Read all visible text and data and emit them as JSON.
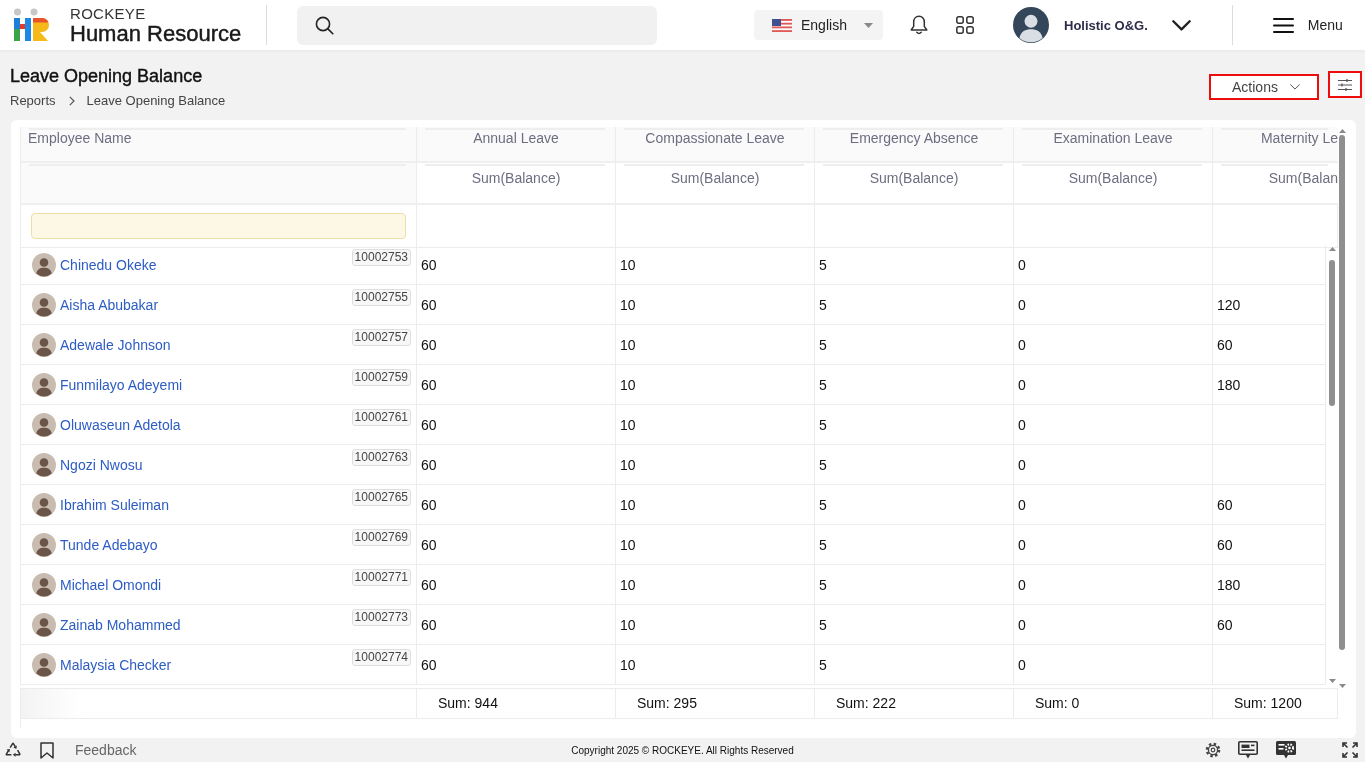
{
  "header": {
    "brand_top": "ROCKEYE",
    "brand_name": "Human Resource",
    "language": "English",
    "user_name": "Holistic O&G.",
    "menu_label": "Menu"
  },
  "page": {
    "title": "Leave Opening Balance",
    "breadcrumb": [
      "Reports",
      "Leave Opening Balance"
    ],
    "actions_label": "Actions"
  },
  "table": {
    "first_column": "Employee Name",
    "columns": [
      {
        "title": "Annual Leave",
        "measure": "Sum(Balance)",
        "total": "Sum: 944"
      },
      {
        "title": "Compassionate Leave",
        "measure": "Sum(Balance)",
        "total": "Sum: 295"
      },
      {
        "title": "Emergency Absence",
        "measure": "Sum(Balance)",
        "total": "Sum: 222"
      },
      {
        "title": "Examination Leave",
        "measure": "Sum(Balance)",
        "total": "Sum: 0"
      },
      {
        "title": "Maternity Le",
        "measure": "Sum(Balan",
        "total": "Sum: 1200"
      }
    ],
    "rows": [
      {
        "name": "Chinedu Okeke",
        "employee_id": "10002753",
        "values": [
          "60",
          "10",
          "5",
          "0"
        ]
      },
      {
        "name": "Aisha Abubakar",
        "employee_id": "10002755",
        "values": [
          "60",
          "10",
          "5",
          "0",
          "120"
        ]
      },
      {
        "name": "Adewale Johnson",
        "employee_id": "10002757",
        "values": [
          "60",
          "10",
          "5",
          "0",
          "60"
        ]
      },
      {
        "name": "Funmilayo Adeyemi",
        "employee_id": "10002759",
        "values": [
          "60",
          "10",
          "5",
          "0",
          "180"
        ]
      },
      {
        "name": "Oluwaseun Adetola",
        "employee_id": "10002761",
        "values": [
          "60",
          "10",
          "5",
          "0"
        ]
      },
      {
        "name": "Ngozi Nwosu",
        "employee_id": "10002763",
        "values": [
          "60",
          "10",
          "5",
          "0"
        ]
      },
      {
        "name": "Ibrahim Suleiman",
        "employee_id": "10002765",
        "values": [
          "60",
          "10",
          "5",
          "0",
          "60"
        ]
      },
      {
        "name": "Tunde Adebayo",
        "employee_id": "10002769",
        "values": [
          "60",
          "10",
          "5",
          "0",
          "60"
        ]
      },
      {
        "name": "Michael Omondi",
        "employee_id": "10002771",
        "values": [
          "60",
          "10",
          "5",
          "0",
          "180"
        ]
      },
      {
        "name": "Zainab Mohammed",
        "employee_id": "10002773",
        "values": [
          "60",
          "10",
          "5",
          "0",
          "60"
        ]
      },
      {
        "name": "Malaysia Checker",
        "employee_id": "10002774",
        "values": [
          "60",
          "10",
          "5",
          "0"
        ]
      }
    ]
  },
  "footer": {
    "feedback": "Feedback",
    "copyright": "Copyright 2025 © ROCKEYE. All Rights Reserved"
  }
}
